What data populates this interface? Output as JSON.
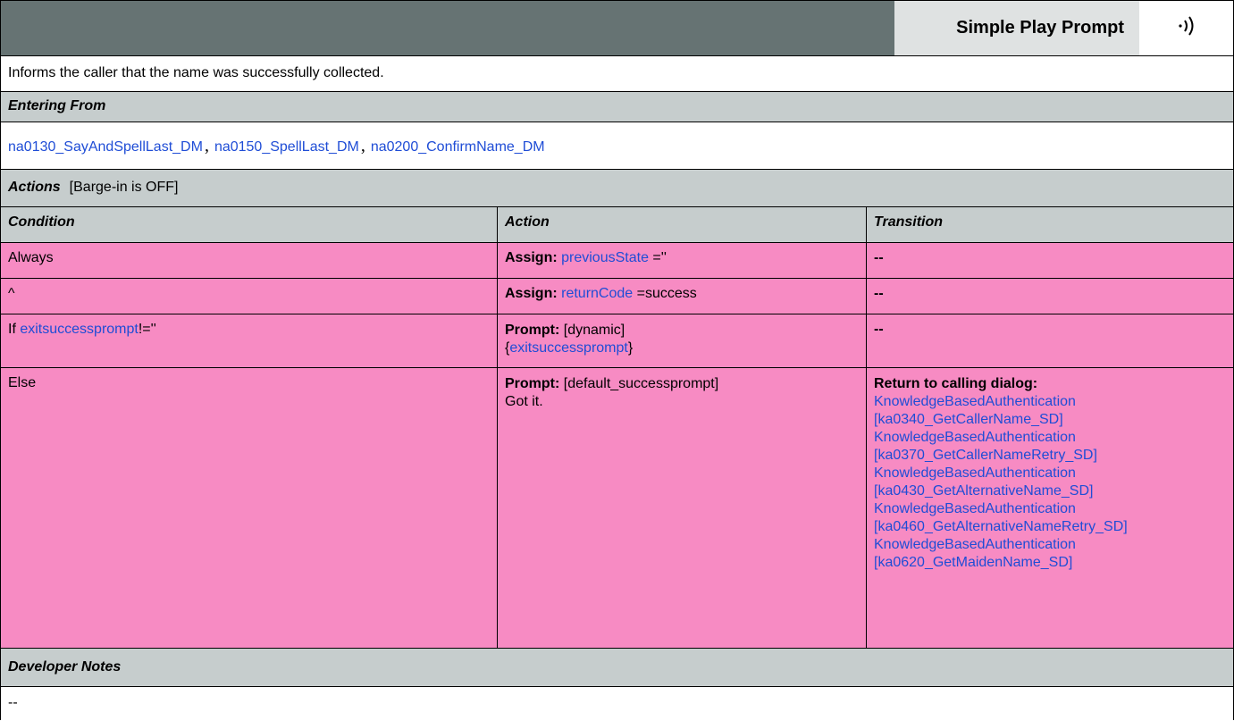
{
  "header": {
    "title": "Simple Play Prompt",
    "icon": "speaker-icon"
  },
  "description": "Informs the caller that the name was successfully collected.",
  "entering_from": {
    "heading": "Entering From",
    "links": [
      "na0130_SayAndSpellLast_DM",
      "na0150_SpellLast_DM",
      "na0200_ConfirmName_DM"
    ],
    "separator": ","
  },
  "actions": {
    "heading": "Actions",
    "barge_in": "[Barge-in is OFF]",
    "columns": [
      "Condition",
      "Action",
      "Transition"
    ],
    "rows": [
      {
        "condition": "Always",
        "action_label": "Assign:",
        "action_var": "previousState",
        "action_value": " =''",
        "transition": "--"
      },
      {
        "condition": "^",
        "action_label": "Assign:",
        "action_var": "returnCode",
        "action_value": " =success",
        "transition": "--"
      },
      {
        "condition_prefix": "If ",
        "condition_var": "exitsuccessprompt",
        "condition_suffix": "!=''",
        "action_label": "Prompt:",
        "action_value": " [dynamic]",
        "action_line2_open": "{",
        "action_line2_var": "exitsuccessprompt",
        "action_line2_close": "}",
        "transition": "--"
      },
      {
        "condition": "Else",
        "action_label": "Prompt:",
        "action_value": " [default_successprompt]",
        "action_line2": "Got it.",
        "transition_label": "Return to calling dialog:",
        "transition_links": [
          "KnowledgeBasedAuthentication",
          "[ka0340_GetCallerName_SD]",
          "KnowledgeBasedAuthentication",
          "[ka0370_GetCallerNameRetry_SD]",
          "KnowledgeBasedAuthentication",
          "[ka0430_GetAlternativeName_SD]",
          "KnowledgeBasedAuthentication",
          "[ka0460_GetAlternativeNameRetry_SD]",
          "KnowledgeBasedAuthentication",
          "[ka0620_GetMaidenName_SD]"
        ]
      }
    ]
  },
  "developer_notes": {
    "heading": "Developer Notes",
    "text": "--"
  },
  "colors": {
    "header_bar": "#667373",
    "section_bg": "#c6cdcd",
    "row_bg": "#f78bc3",
    "link": "#1f4dd6"
  }
}
